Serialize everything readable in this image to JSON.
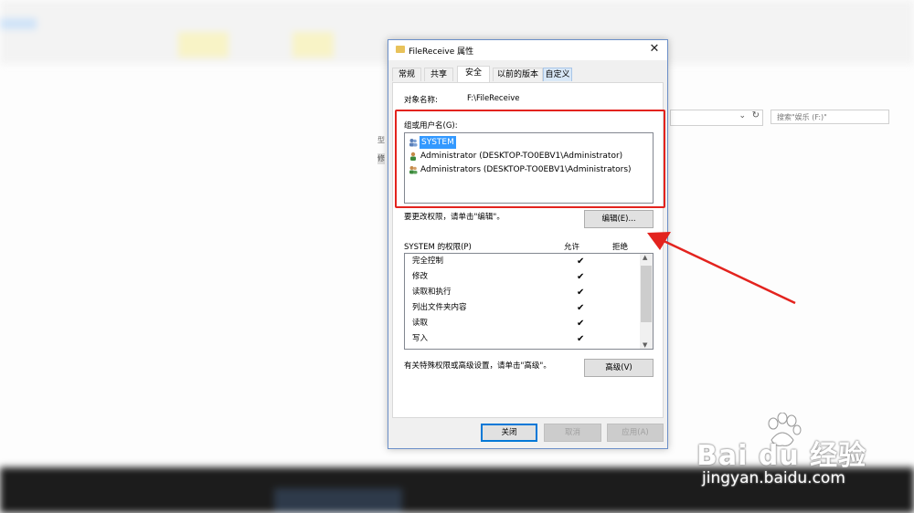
{
  "background": {
    "address_refresh_icon": "refresh-icon",
    "search_placeholder": "搜索\"娱乐 (F:)\""
  },
  "dialog": {
    "title": "FileReceive 属性",
    "close_label": "✕",
    "tabs": [
      {
        "label": "常规"
      },
      {
        "label": "共享"
      },
      {
        "label": "安全"
      },
      {
        "label": "以前的版本"
      },
      {
        "label": "自定义"
      }
    ],
    "active_tab": "安全",
    "object_name_label": "对象名称:",
    "object_name_value": "F:\\FileReceive",
    "group_label": "组或用户名(G):",
    "users": [
      {
        "name": "SYSTEM",
        "selected": true,
        "icon": "user-group-icon"
      },
      {
        "name": "Administrator (DESKTOP-TO0EBV1\\Administrator)",
        "selected": false,
        "icon": "user-icon"
      },
      {
        "name": "Administrators (DESKTOP-TO0EBV1\\Administrators)",
        "selected": false,
        "icon": "user-group-icon"
      }
    ],
    "edit_hint": "要更改权限，请单击\"编辑\"。",
    "edit_button": "编辑(E)...",
    "permissions_title": "SYSTEM 的权限(P)",
    "allow_header": "允许",
    "deny_header": "拒绝",
    "permissions": [
      {
        "name": "完全控制",
        "allow": "✔",
        "deny": ""
      },
      {
        "name": "修改",
        "allow": "✔",
        "deny": ""
      },
      {
        "name": "读取和执行",
        "allow": "✔",
        "deny": ""
      },
      {
        "name": "列出文件夹内容",
        "allow": "✔",
        "deny": ""
      },
      {
        "name": "读取",
        "allow": "✔",
        "deny": ""
      },
      {
        "name": "写入",
        "allow": "✔",
        "deny": ""
      }
    ],
    "advanced_hint": "有关特殊权限或高级设置，请单击\"高级\"。",
    "advanced_button": "高级(V)",
    "close_button": "关闭",
    "cancel_button": "取消",
    "apply_button": "应用(A)"
  },
  "annotation": {
    "highlight_color": "#e3231e"
  },
  "watermark": {
    "brand": "Bai du 经验",
    "url": "jingyan.baidu.com"
  }
}
